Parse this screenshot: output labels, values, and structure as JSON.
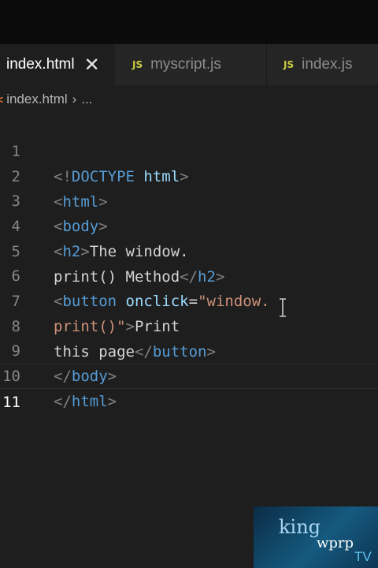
{
  "tabs": [
    {
      "label": "index.html",
      "close": "✕",
      "active": true
    },
    {
      "label": "myscript.js",
      "badge": "JS"
    },
    {
      "label": "index.js",
      "badge": "JS"
    }
  ],
  "breadcrumb": {
    "file": "index.html",
    "separator": "›",
    "more": "..."
  },
  "editor": {
    "line_numbers": [
      "1",
      "2",
      "3",
      "4",
      "5",
      "6",
      "7",
      "8",
      "9",
      "10",
      "11"
    ],
    "lines": [
      "<!DOCTYPE html>",
      "<html>",
      "<body>",
      "<h2>The window.",
      "print() Method</h2>",
      "<button onclick=\"window.",
      "print()\">Print",
      "this page</button>",
      "</body>",
      "</html>",
      ""
    ],
    "current_line": "11"
  },
  "watermark": {
    "line1": "king",
    "line2": "wprp",
    "line3": "TV"
  },
  "colors": {
    "tag": "#569cd6",
    "attribute": "#9cdcfe",
    "string": "#ce9178",
    "bracket": "#808080",
    "text": "#d4d4d4",
    "js_badge": "#cbcb41"
  }
}
